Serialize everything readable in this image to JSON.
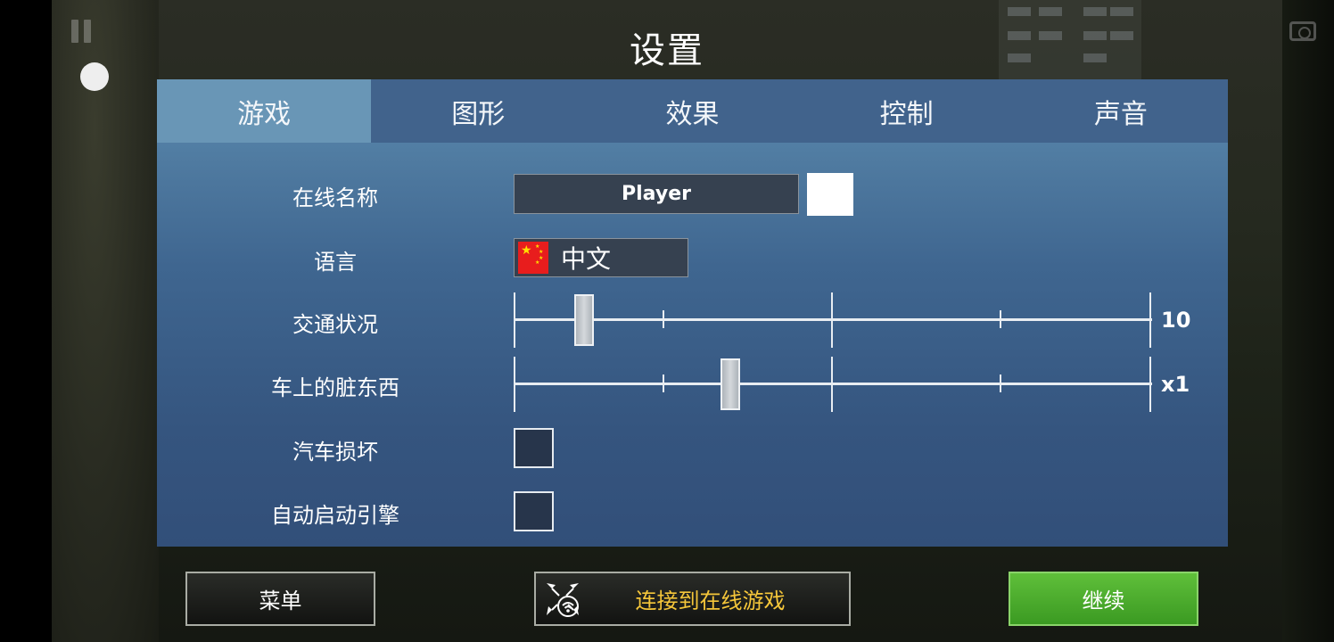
{
  "title": "设置",
  "tabs": [
    {
      "label": "游戏",
      "active": true
    },
    {
      "label": "图形",
      "active": false
    },
    {
      "label": "效果",
      "active": false
    },
    {
      "label": "控制",
      "active": false
    },
    {
      "label": "声音",
      "active": false
    }
  ],
  "settings": {
    "online_name": {
      "label": "在线名称",
      "value": "Player",
      "color": "#ffffff"
    },
    "language": {
      "label": "语言",
      "value": "中文",
      "flag": "china-flag-icon"
    },
    "traffic": {
      "label": "交通状况",
      "value_text": "10",
      "level": 0.11
    },
    "car_dirt": {
      "label": "车上的脏东西",
      "value_text": "x1",
      "level": 0.34
    },
    "car_damage": {
      "label": "汽车损坏",
      "checked": false
    },
    "auto_start_engine": {
      "label": "自动启动引擎",
      "checked": false
    }
  },
  "buttons": {
    "menu": "菜单",
    "connect_online": "连接到在线游戏",
    "continue": "继续"
  },
  "colors": {
    "active_tab": "#6996b6",
    "tab_bar": "#41638c",
    "continue_green": "#4caf2e",
    "online_text": "#f5c63a"
  }
}
